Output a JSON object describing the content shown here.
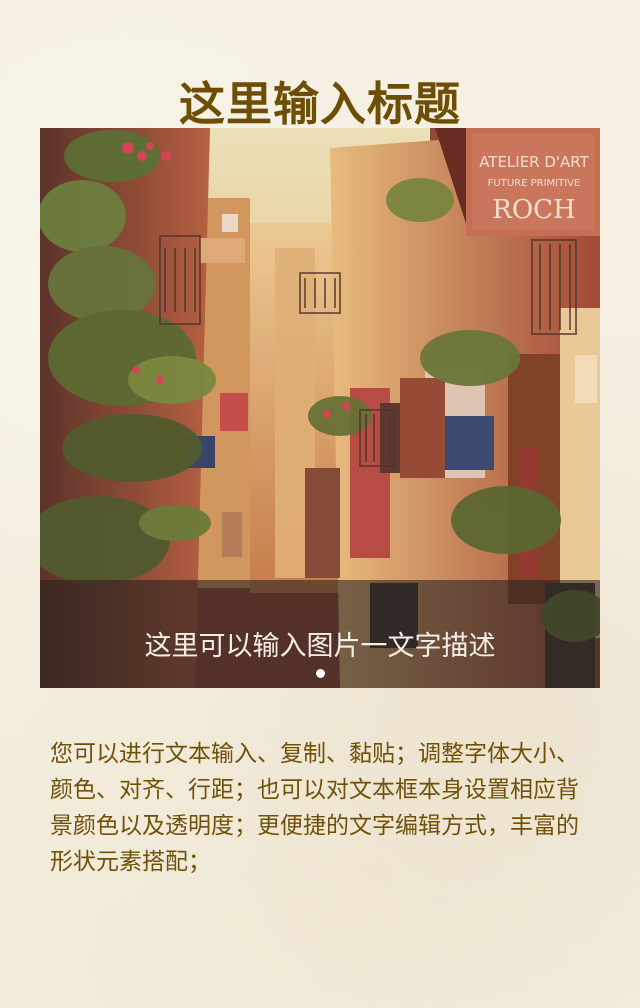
{
  "page": {
    "title": "这里输入标题"
  },
  "hero": {
    "caption": "这里可以输入图片一文字描述",
    "indicator_active_index": 1,
    "sign_lines": [
      "ATELIER D'ART",
      "FUTURE PRIMITIVE",
      "ROCH"
    ]
  },
  "body": {
    "text": "您可以进行文本输入、复制、黏贴；调整字体大小、颜色、对齐、行距；也可以对文本框本身设置相应背景颜色以及透明度；更便捷的文字编辑方式，丰富的形状元素搭配；"
  },
  "colors": {
    "title": "#6e4d05",
    "body_text": "#71510a",
    "background": "#f4efe1"
  }
}
